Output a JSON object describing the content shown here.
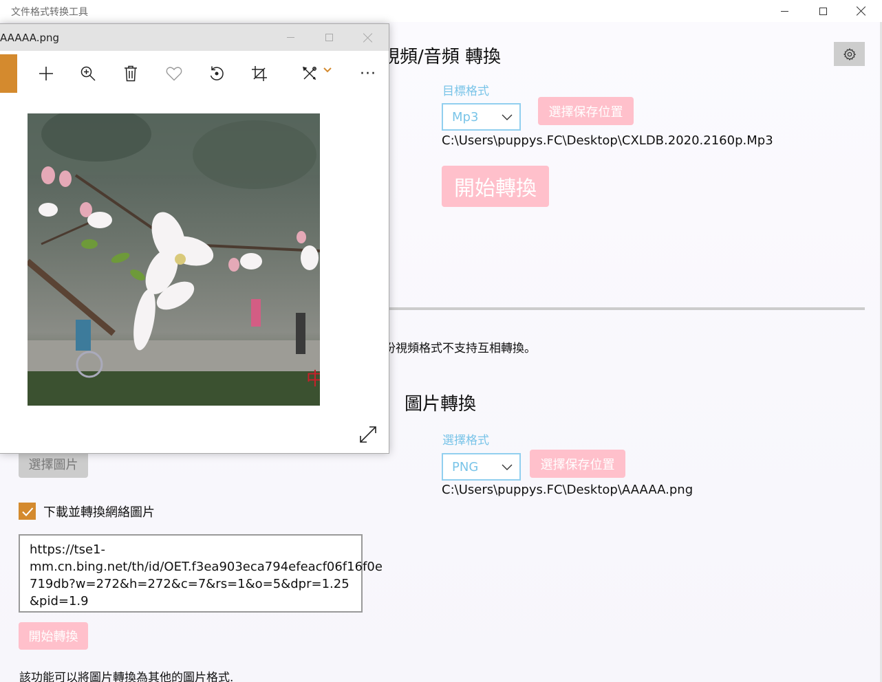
{
  "main_window": {
    "title": "文件格式转换工具",
    "settings_icon": "gear-icon"
  },
  "video_section": {
    "heading": "視頻/音頻 轉換",
    "target_format_label": "目標格式",
    "format_value": "Mp3",
    "save_location_button": "選擇保存位置",
    "output_path": "C:\\Users\\puppys.FC\\Desktop\\CXLDB.2020.2160p.Mp3",
    "start_button": "開始轉換",
    "note": "份視頻格式不支持互相轉換。"
  },
  "image_section": {
    "heading": "圖片轉換",
    "select_format_label": "選擇格式",
    "format_value": "PNG",
    "save_location_button": "選擇保存位置",
    "output_path": "C:\\Users\\puppys.FC\\Desktop\\AAAAA.png",
    "select_image_button": "選擇圖片",
    "download_checkbox_label": "下載並轉換網絡圖片",
    "download_checked": true,
    "url_lines": [
      "https://tse1-",
      "mm.cn.bing.net/th/id/OET.f3ea903eca794efeacf06f16f0e",
      "719db?w=272&h=272&c=7&rs=1&o=5&dpr=1.25",
      "&pid=1.9"
    ],
    "start_button": "開始轉換",
    "description": "該功能可以將圖片轉換為其他的圖片格式."
  },
  "photo_viewer": {
    "title": "AAAAA.png",
    "toolbar_icons": [
      "add-icon",
      "zoom-icon",
      "delete-icon",
      "favorite-icon",
      "rotate-icon",
      "crop-icon",
      "edit-icon",
      "more-icon"
    ],
    "more_label": "···",
    "accent_color": "#d48a2e"
  }
}
